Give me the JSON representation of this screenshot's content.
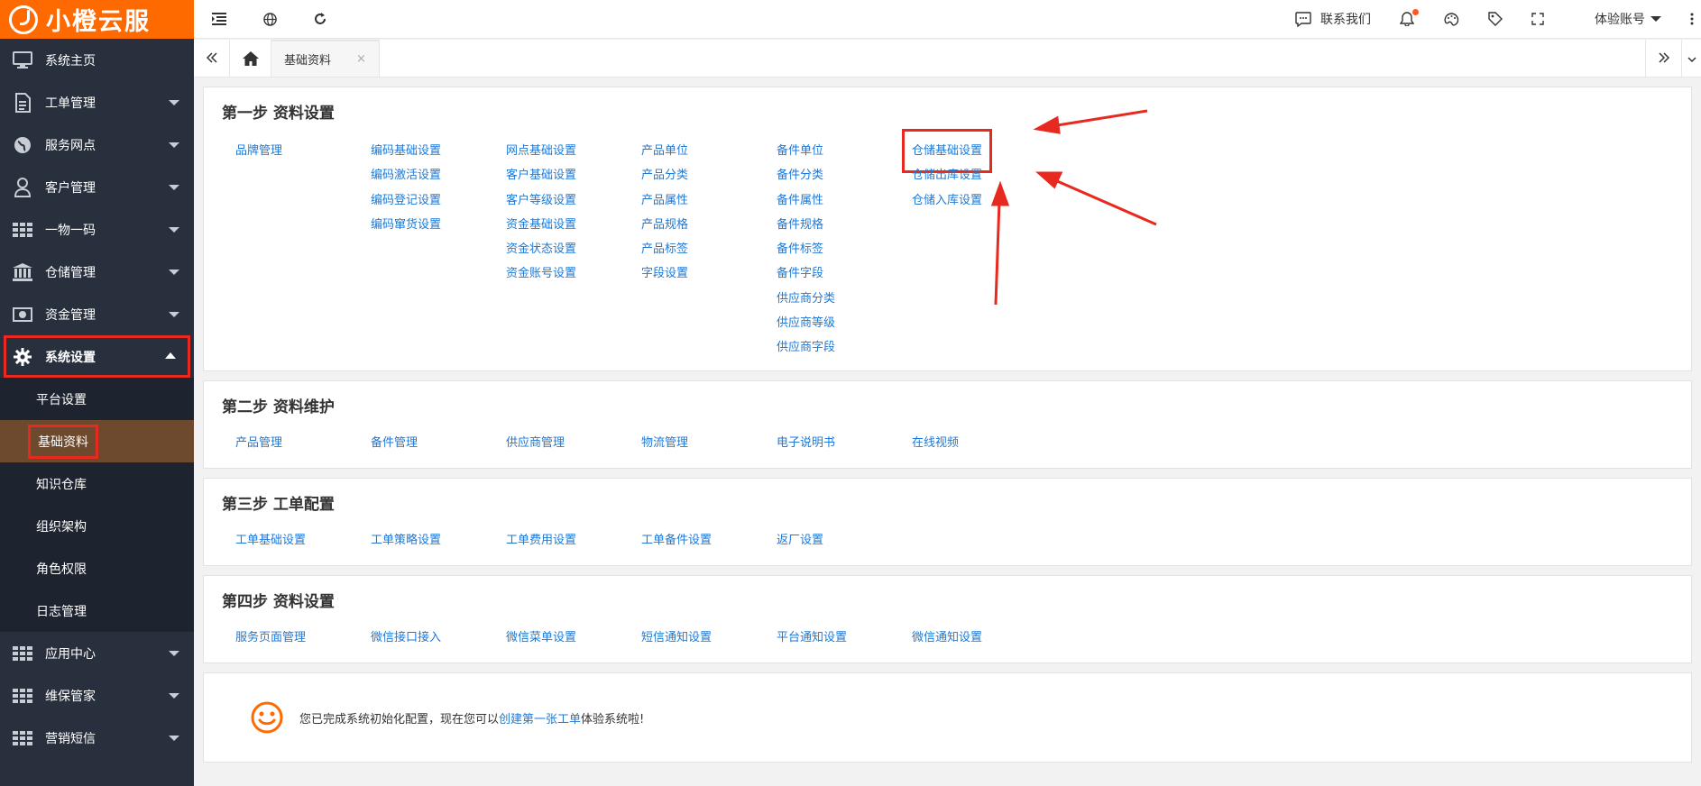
{
  "logo": {
    "text": "小橙云服"
  },
  "sidebar": {
    "items": [
      {
        "label": "系统主页",
        "icon": "monitor-icon",
        "caret": false
      },
      {
        "label": "工单管理",
        "icon": "document-icon",
        "caret": true
      },
      {
        "label": "服务网点",
        "icon": "globe-icon",
        "caret": true
      },
      {
        "label": "客户管理",
        "icon": "user-icon",
        "caret": true
      },
      {
        "label": "一物一码",
        "icon": "grid-icon",
        "caret": true
      },
      {
        "label": "仓储管理",
        "icon": "bank-icon",
        "caret": true
      },
      {
        "label": "资金管理",
        "icon": "money-icon",
        "caret": true
      },
      {
        "label": "系统设置",
        "icon": "gear-icon",
        "caret": true,
        "expanded": true
      }
    ],
    "sub_items": [
      {
        "label": "平台设置"
      },
      {
        "label": "基础资料",
        "active": true
      },
      {
        "label": "知识仓库"
      },
      {
        "label": "组织架构"
      },
      {
        "label": "角色权限"
      },
      {
        "label": "日志管理"
      }
    ],
    "bottom_items": [
      {
        "label": "应用中心",
        "icon": "grid-icon"
      },
      {
        "label": "维保管家",
        "icon": "grid-icon"
      },
      {
        "label": "营销短信",
        "icon": "grid-icon"
      }
    ]
  },
  "topbar": {
    "contact_label": "联系我们",
    "account_label": "体验账号"
  },
  "tabs": {
    "active_label": "基础资料",
    "close_glyph": "×"
  },
  "step1": {
    "title": "第一步 资料设置",
    "columns": [
      [
        "品牌管理"
      ],
      [
        "编码基础设置",
        "编码激活设置",
        "编码登记设置",
        "编码窜货设置"
      ],
      [
        "网点基础设置",
        "客户基础设置",
        "客户等级设置",
        "资金基础设置",
        "资金状态设置",
        "资金账号设置"
      ],
      [
        "产品单位",
        "产品分类",
        "产品属性",
        "产品规格",
        "产品标签",
        "字段设置"
      ],
      [
        "备件单位",
        "备件分类",
        "备件属性",
        "备件规格",
        "备件标签",
        "备件字段",
        "供应商分类",
        "供应商等级",
        "供应商字段"
      ],
      [
        "仓储基础设置",
        "仓储出库设置",
        "仓储入库设置"
      ]
    ]
  },
  "step2": {
    "title": "第二步 资料维护",
    "links": [
      "产品管理",
      "备件管理",
      "供应商管理",
      "物流管理",
      "电子说明书",
      "在线视频"
    ]
  },
  "step3": {
    "title": "第三步 工单配置",
    "links": [
      "工单基础设置",
      "工单策略设置",
      "工单费用设置",
      "工单备件设置",
      "返厂设置"
    ]
  },
  "step4": {
    "title": "第四步 资料设置",
    "links": [
      "服务页面管理",
      "微信接口接入",
      "微信菜单设置",
      "短信通知设置",
      "平台通知设置",
      "微信通知设置"
    ]
  },
  "done": {
    "prefix": "您已完成系统初始化配置，现在您可以",
    "link": "创建第一张工单",
    "suffix": "体验系统啦!"
  },
  "colors": {
    "brand": "#ff6a00",
    "sidebar_bg": "#28303e",
    "link": "#1e79d6",
    "annotation_red": "#e8291f"
  }
}
